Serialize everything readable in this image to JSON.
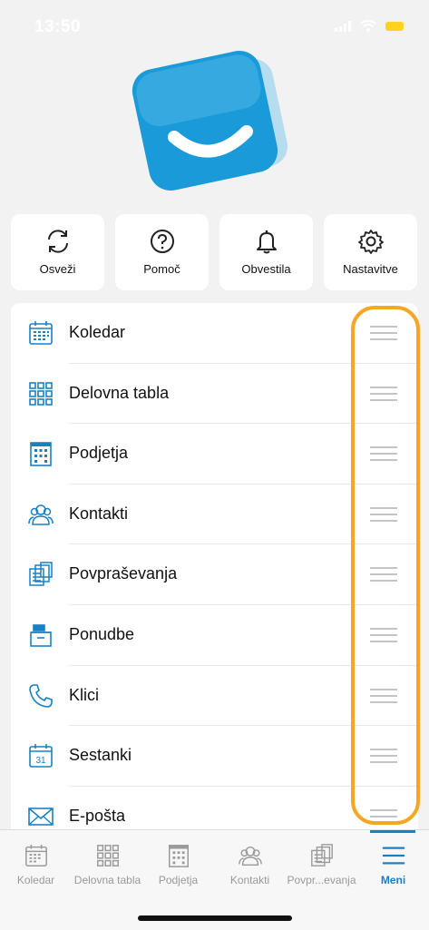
{
  "status_bar": {
    "time": "13:50",
    "battery_color": "#ffd21f"
  },
  "logo": {
    "icon": "smile-logo-icon",
    "color": "#1a9ad8"
  },
  "quick_actions": [
    {
      "label": "Osveži",
      "icon": "refresh-icon"
    },
    {
      "label": "Pomoč",
      "icon": "help-icon"
    },
    {
      "label": "Obvestila",
      "icon": "bell-icon"
    },
    {
      "label": "Nastavitve",
      "icon": "gear-icon"
    }
  ],
  "menu_items": [
    {
      "label": "Koledar",
      "icon": "calendar-icon"
    },
    {
      "label": "Delovna tabla",
      "icon": "grid-icon"
    },
    {
      "label": "Podjetja",
      "icon": "building-icon"
    },
    {
      "label": "Kontakti",
      "icon": "contacts-icon"
    },
    {
      "label": "Povpraševanja",
      "icon": "inquiries-icon"
    },
    {
      "label": "Ponudbe",
      "icon": "offers-icon"
    },
    {
      "label": "Klici",
      "icon": "phone-icon"
    },
    {
      "label": "Sestanki",
      "icon": "meeting-calendar-icon",
      "day": "31"
    },
    {
      "label": "E-pošta",
      "icon": "mail-icon"
    }
  ],
  "tab_bar": [
    {
      "label": "Koledar",
      "icon": "calendar-icon"
    },
    {
      "label": "Delovna tabla",
      "icon": "grid-icon"
    },
    {
      "label": "Podjetja",
      "icon": "building-icon"
    },
    {
      "label": "Kontakti",
      "icon": "contacts-icon"
    },
    {
      "label": "Povpr...evanja",
      "icon": "inquiries-icon"
    },
    {
      "label": "Meni",
      "icon": "menu-icon",
      "active": true
    }
  ],
  "colors": {
    "accent": "#1a80c4",
    "highlight": "#f5a623"
  }
}
